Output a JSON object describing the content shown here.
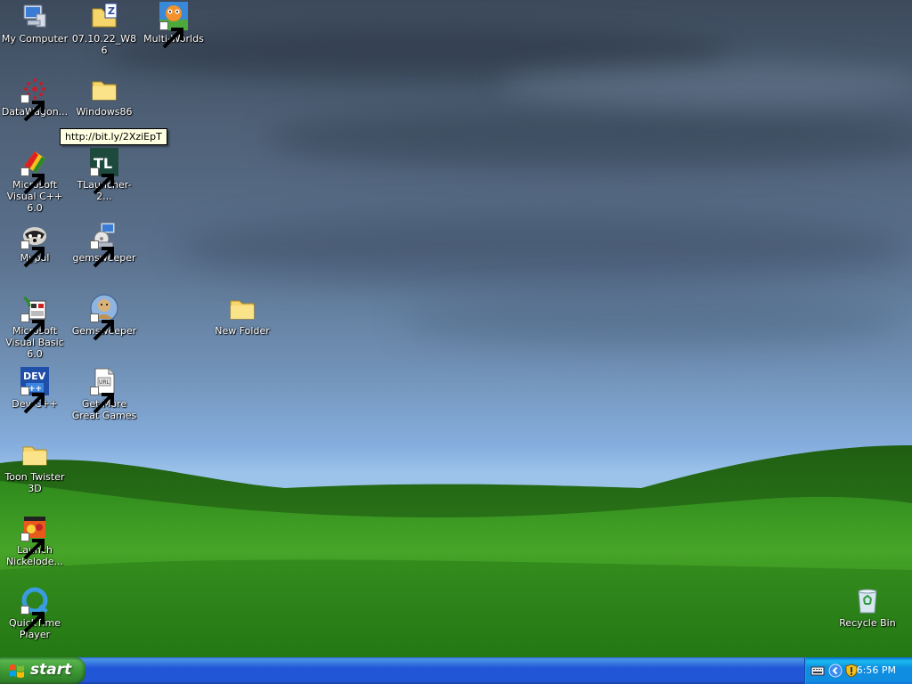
{
  "desktop": {
    "icons": [
      {
        "label": "My Computer",
        "icon": "computer-icon",
        "shortcut": false
      },
      {
        "label": "07.10.22_W86",
        "icon": "zipped-folder-icon",
        "shortcut": false
      },
      {
        "label": "Multi-Worlds",
        "icon": "multi-worlds-icon",
        "shortcut": true
      },
      {
        "label": "DataWagon...",
        "icon": "datawagon-icon",
        "shortcut": true
      },
      {
        "label": "Windows86",
        "icon": "folder-icon",
        "shortcut": false
      },
      {
        "label": "Microsoft Visual C++ 6.0",
        "icon": "visual-cpp-icon",
        "shortcut": true
      },
      {
        "label": "TLauncher-2...",
        "icon": "tlauncher-icon",
        "shortcut": true
      },
      {
        "label": "Mypal",
        "icon": "mypal-icon",
        "shortcut": true
      },
      {
        "label": "gemsweeper",
        "icon": "installer-icon",
        "shortcut": true
      },
      {
        "label": "Microsoft Visual Basic 6.0",
        "icon": "visual-basic-icon",
        "shortcut": true
      },
      {
        "label": "Gemsweeper",
        "icon": "gemsweeper-icon",
        "shortcut": true
      },
      {
        "label": "New Folder",
        "icon": "folder-icon",
        "shortcut": false
      },
      {
        "label": "Dev-C++",
        "icon": "devcpp-icon",
        "shortcut": true
      },
      {
        "label": "Get More Great Games",
        "icon": "document-icon",
        "shortcut": true
      },
      {
        "label": "Toon Twister 3D",
        "icon": "folder-icon",
        "shortcut": false
      },
      {
        "label": "Launch Nickelode...",
        "icon": "nickelodeon-icon",
        "shortcut": true
      },
      {
        "label": "QuickTime Player",
        "icon": "quicktime-icon",
        "shortcut": true
      },
      {
        "label": "Recycle Bin",
        "icon": "recycle-bin-icon",
        "shortcut": false
      }
    ],
    "tooltip": "http://bit.ly/2XziEpT"
  },
  "taskbar": {
    "start_label": "start",
    "tray_icons": [
      "keyboard-icon",
      "show-hidden-icons-icon",
      "security-shield-icon"
    ],
    "clock": "6:56 PM"
  },
  "colors": {
    "taskbar_blue": "#2157d7",
    "start_green": "#3d9a35",
    "tray_blue": "#0f8de1",
    "tooltip_bg": "#ffffe1"
  }
}
